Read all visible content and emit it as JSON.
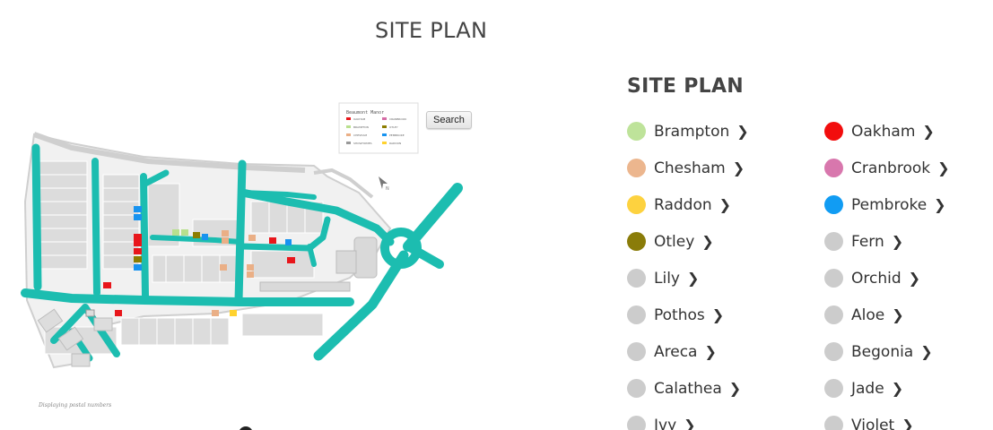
{
  "page": {
    "title": "SITE PLAN"
  },
  "map": {
    "search_label": "Search",
    "caption": "Displaying postal numbers",
    "road_color": "#1cbdb0",
    "road_names": [
      "Beaumont Manor"
    ],
    "key_title": "Beaumont Manor",
    "key_items": [
      {
        "label": "OAKHAM",
        "color": "#e8161b"
      },
      {
        "label": "CRANBROOK",
        "color": "#d56ca5"
      },
      {
        "label": "BRAMPTON",
        "color": "#b9e08e"
      },
      {
        "label": "OTLEY",
        "color": "#8c7d00"
      },
      {
        "label": "CHESHAM",
        "color": "#eaaf86"
      },
      {
        "label": "PEMBROKE",
        "color": "#1793f0"
      },
      {
        "label": "SHOWHOMES",
        "color": "#999999"
      },
      {
        "label": "RADDON",
        "color": "#ffd22e"
      }
    ]
  },
  "legend": {
    "title": "SITE PLAN",
    "chevron": "❯",
    "left": [
      {
        "label": "Brampton",
        "color": "#bee39a"
      },
      {
        "label": "Chesham",
        "color": "#ecb68e"
      },
      {
        "label": "Raddon",
        "color": "#fdd23f"
      },
      {
        "label": "Otley",
        "color": "#8a7c09"
      },
      {
        "label": "Lily",
        "color": "#cccccc"
      },
      {
        "label": "Pothos",
        "color": "#cccccc"
      },
      {
        "label": "Areca",
        "color": "#cccccc"
      },
      {
        "label": "Calathea",
        "color": "#cccccc"
      },
      {
        "label": "Ivy",
        "color": "#cccccc"
      }
    ],
    "right": [
      {
        "label": "Oakham",
        "color": "#f20d0d"
      },
      {
        "label": "Cranbrook",
        "color": "#d877ad"
      },
      {
        "label": "Pembroke",
        "color": "#119cf3"
      },
      {
        "label": "Fern",
        "color": "#cccccc"
      },
      {
        "label": "Orchid",
        "color": "#cccccc"
      },
      {
        "label": "Aloe",
        "color": "#cccccc"
      },
      {
        "label": "Begonia",
        "color": "#cccccc"
      },
      {
        "label": "Jade",
        "color": "#cccccc"
      },
      {
        "label": "Violet",
        "color": "#cccccc"
      }
    ]
  }
}
